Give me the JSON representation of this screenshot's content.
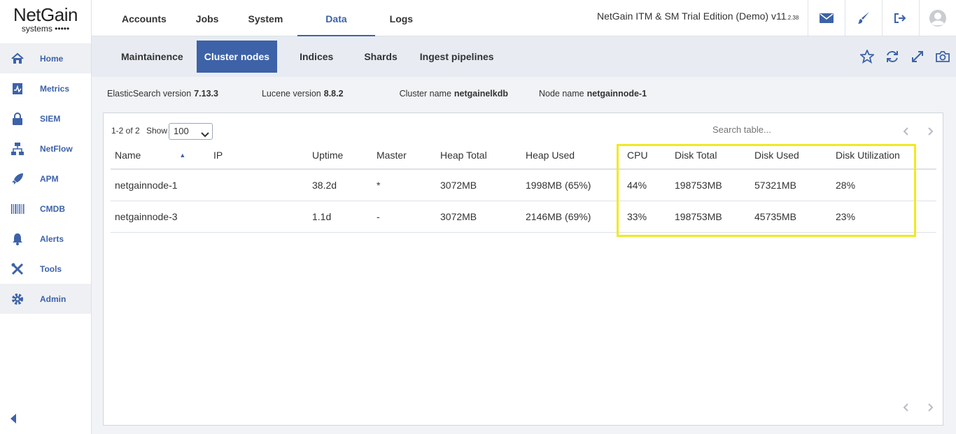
{
  "logo": {
    "name": "NetGain",
    "sub": "systems •••••"
  },
  "sidebar": {
    "items": [
      {
        "label": "Home",
        "icon": "home-icon"
      },
      {
        "label": "Metrics",
        "icon": "metrics-icon"
      },
      {
        "label": "SIEM",
        "icon": "lock-icon"
      },
      {
        "label": "NetFlow",
        "icon": "netflow-icon"
      },
      {
        "label": "APM",
        "icon": "rocket-icon"
      },
      {
        "label": "CMDB",
        "icon": "barcode-icon"
      },
      {
        "label": "Alerts",
        "icon": "bell-icon"
      },
      {
        "label": "Tools",
        "icon": "tools-icon"
      },
      {
        "label": "Admin",
        "icon": "gear-icon"
      }
    ]
  },
  "topnav": {
    "tabs": [
      "Accounts",
      "Jobs",
      "System",
      "Data",
      "Logs"
    ],
    "active": "Data",
    "edition": "NetGain ITM & SM Trial Edition (Demo) v11",
    "version_suffix": ".2.38"
  },
  "subnav": {
    "tabs": [
      "Maintainence",
      "Cluster nodes",
      "Indices",
      "Shards",
      "Ingest pipelines"
    ],
    "active": "Cluster nodes"
  },
  "info": {
    "es_label": "ElasticSearch version",
    "es_value": "7.13.3",
    "lucene_label": "Lucene version",
    "lucene_value": "8.8.2",
    "cluster_label": "Cluster name",
    "cluster_value": "netgainelkdb",
    "node_label": "Node name",
    "node_value": "netgainnode-1"
  },
  "table": {
    "count": "1-2 of 2",
    "show_label": "Show",
    "show_value": "100",
    "search_placeholder": "Search table...",
    "columns": [
      "Name",
      "IP",
      "Uptime",
      "Master",
      "Heap Total",
      "Heap Used",
      "CPU",
      "Disk Total",
      "Disk Used",
      "Disk Utilization"
    ],
    "rows": [
      [
        "netgainnode-1",
        "",
        "38.2d",
        "*",
        "3072MB",
        "1998MB (65%)",
        "44%",
        "198753MB",
        "57321MB",
        "28%"
      ],
      [
        "netgainnode-3",
        "",
        "1.1d",
        "-",
        "3072MB",
        "2146MB (69%)",
        "33%",
        "198753MB",
        "45735MB",
        "23%"
      ]
    ]
  },
  "colors": {
    "accent": "#3d62a8",
    "highlight": "#f0ea20",
    "subnav_bg": "#e8ecf2"
  }
}
